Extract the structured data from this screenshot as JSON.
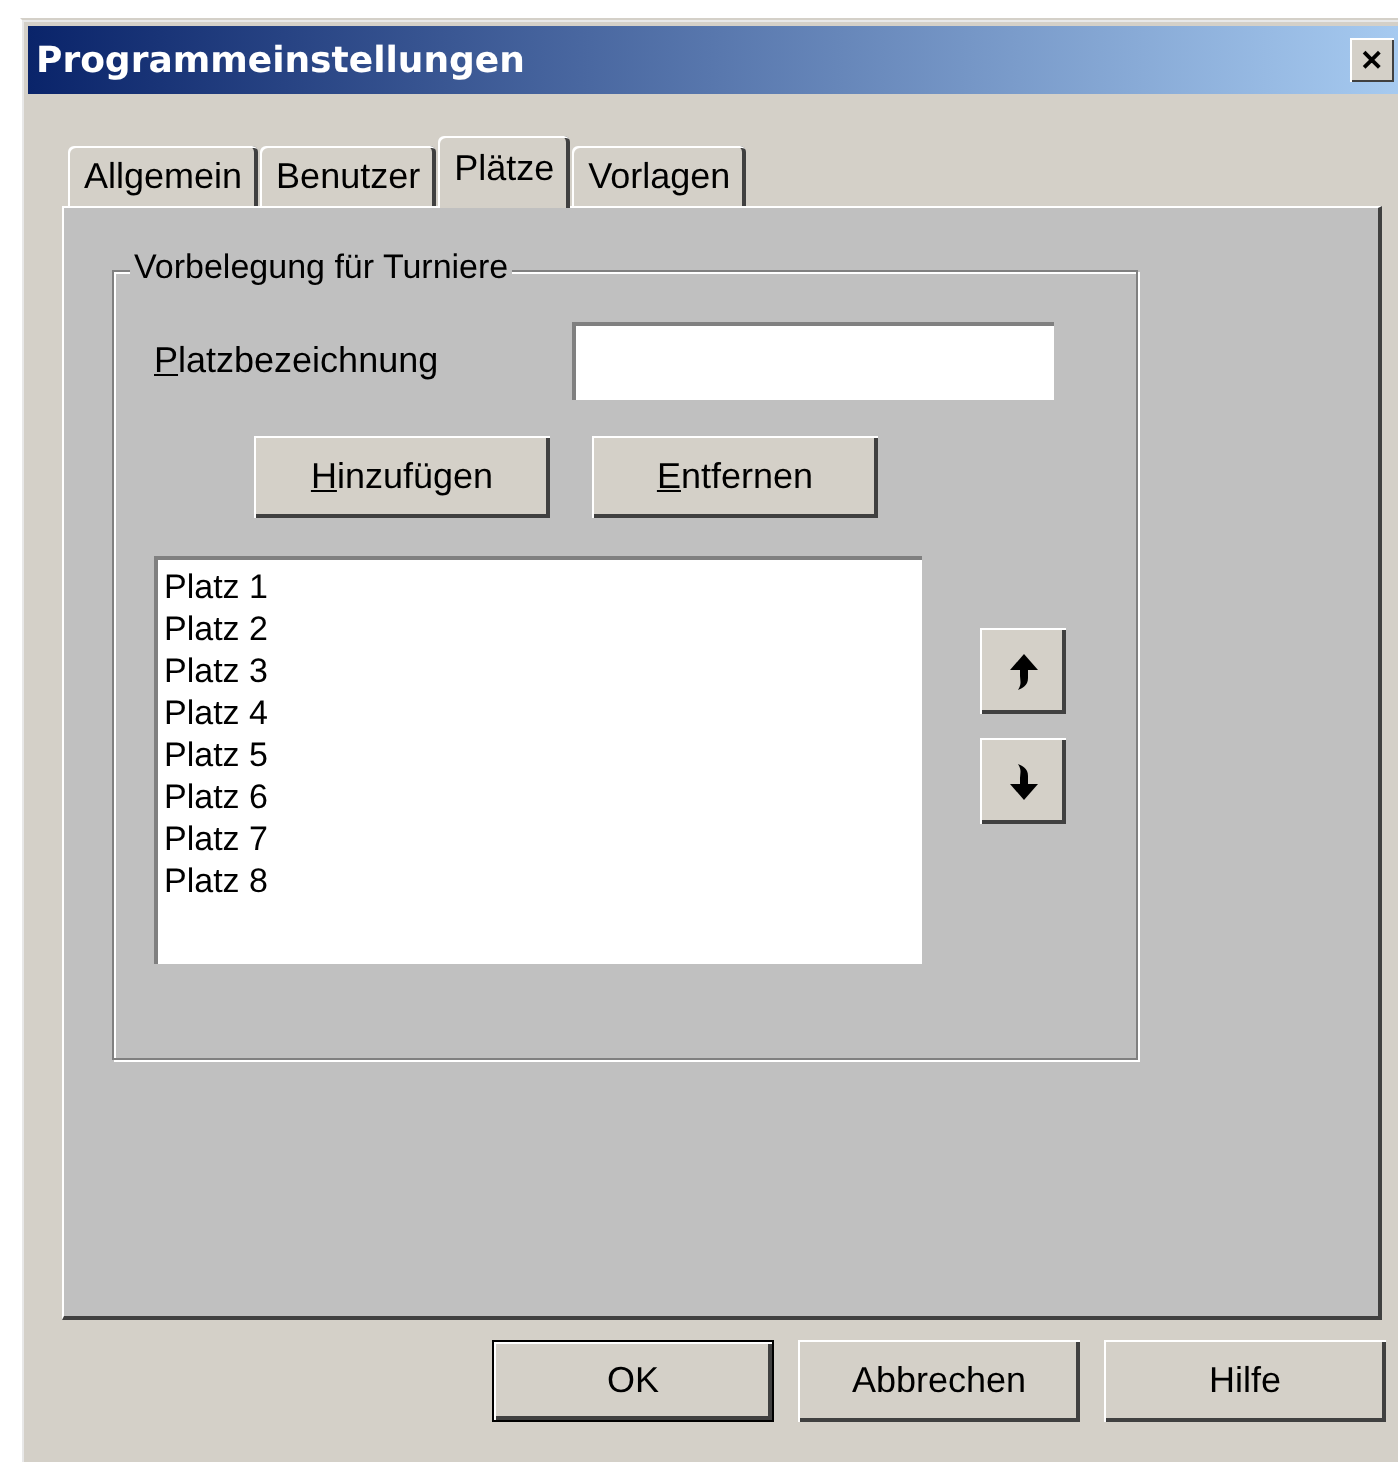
{
  "window": {
    "title": "Programmeinstellungen",
    "close": "✕"
  },
  "tabs": [
    {
      "label": "Allgemein",
      "selected": false
    },
    {
      "label": "Benutzer",
      "selected": false
    },
    {
      "label": "Plätze",
      "selected": true
    },
    {
      "label": "Vorlagen",
      "selected": false
    }
  ],
  "group": {
    "title": "Vorbelegung für Turniere",
    "field": {
      "label": "Platzbezeichnung",
      "underline_first": true
    },
    "buttons": [
      {
        "label": "Hinzufügen",
        "underline_first": true
      },
      {
        "label": "Entfernen",
        "underline_first": true
      }
    ],
    "list": [
      {
        "label": "Platz 1",
        "selected": false
      },
      {
        "label": "Platz 2",
        "selected": false
      },
      {
        "label": "Platz 3",
        "selected": false
      },
      {
        "label": "Platz 4",
        "selected": false
      },
      {
        "label": "Platz 5",
        "selected": false
      },
      {
        "label": "Platz 6",
        "selected": false
      },
      {
        "label": "Platz 7",
        "selected": false
      },
      {
        "label": "Platz 8",
        "selected": false
      }
    ],
    "move_buttons": [
      {
        "kind": "up"
      },
      {
        "kind": "down"
      }
    ]
  },
  "buttons": [
    {
      "label": "OK",
      "default": true
    },
    {
      "label": "Abbrechen",
      "default": false
    },
    {
      "label": "Hilfe",
      "default": false
    }
  ]
}
